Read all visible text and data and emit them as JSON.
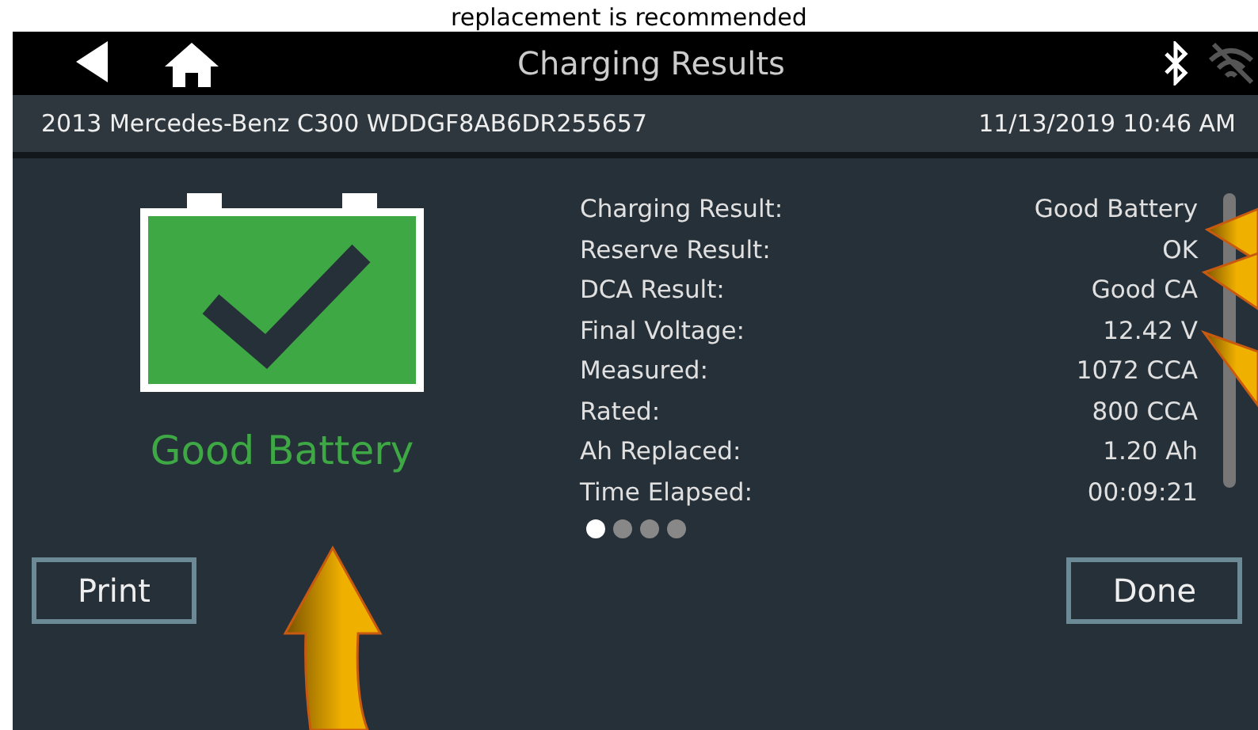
{
  "caption": "replacement is recommended",
  "header": {
    "title": "Charging Results"
  },
  "vehicle_bar": {
    "vehicle": "2013 Mercedes-Benz C300  WDDGF8AB6DR255657",
    "datetime": "11/13/2019 10:46 AM"
  },
  "status": {
    "label": "Good Battery"
  },
  "results": [
    {
      "label": "Charging Result:",
      "value": "Good Battery"
    },
    {
      "label": "Reserve Result:",
      "value": "OK"
    },
    {
      "label": "DCA Result:",
      "value": "Good CA"
    },
    {
      "label": "Final Voltage:",
      "value": "12.42 V"
    },
    {
      "label": "Measured:",
      "value": "1072 CCA"
    },
    {
      "label": "Rated:",
      "value": "800 CCA"
    },
    {
      "label": "Ah Replaced:",
      "value": "1.20 Ah"
    },
    {
      "label": "Time Elapsed:",
      "value": "00:09:21"
    }
  ],
  "pages": [
    {
      "selected": true
    },
    {
      "selected": false
    },
    {
      "selected": false
    },
    {
      "selected": false
    }
  ],
  "buttons": [
    {
      "label": "Print"
    },
    {
      "label": "Done"
    }
  ]
}
